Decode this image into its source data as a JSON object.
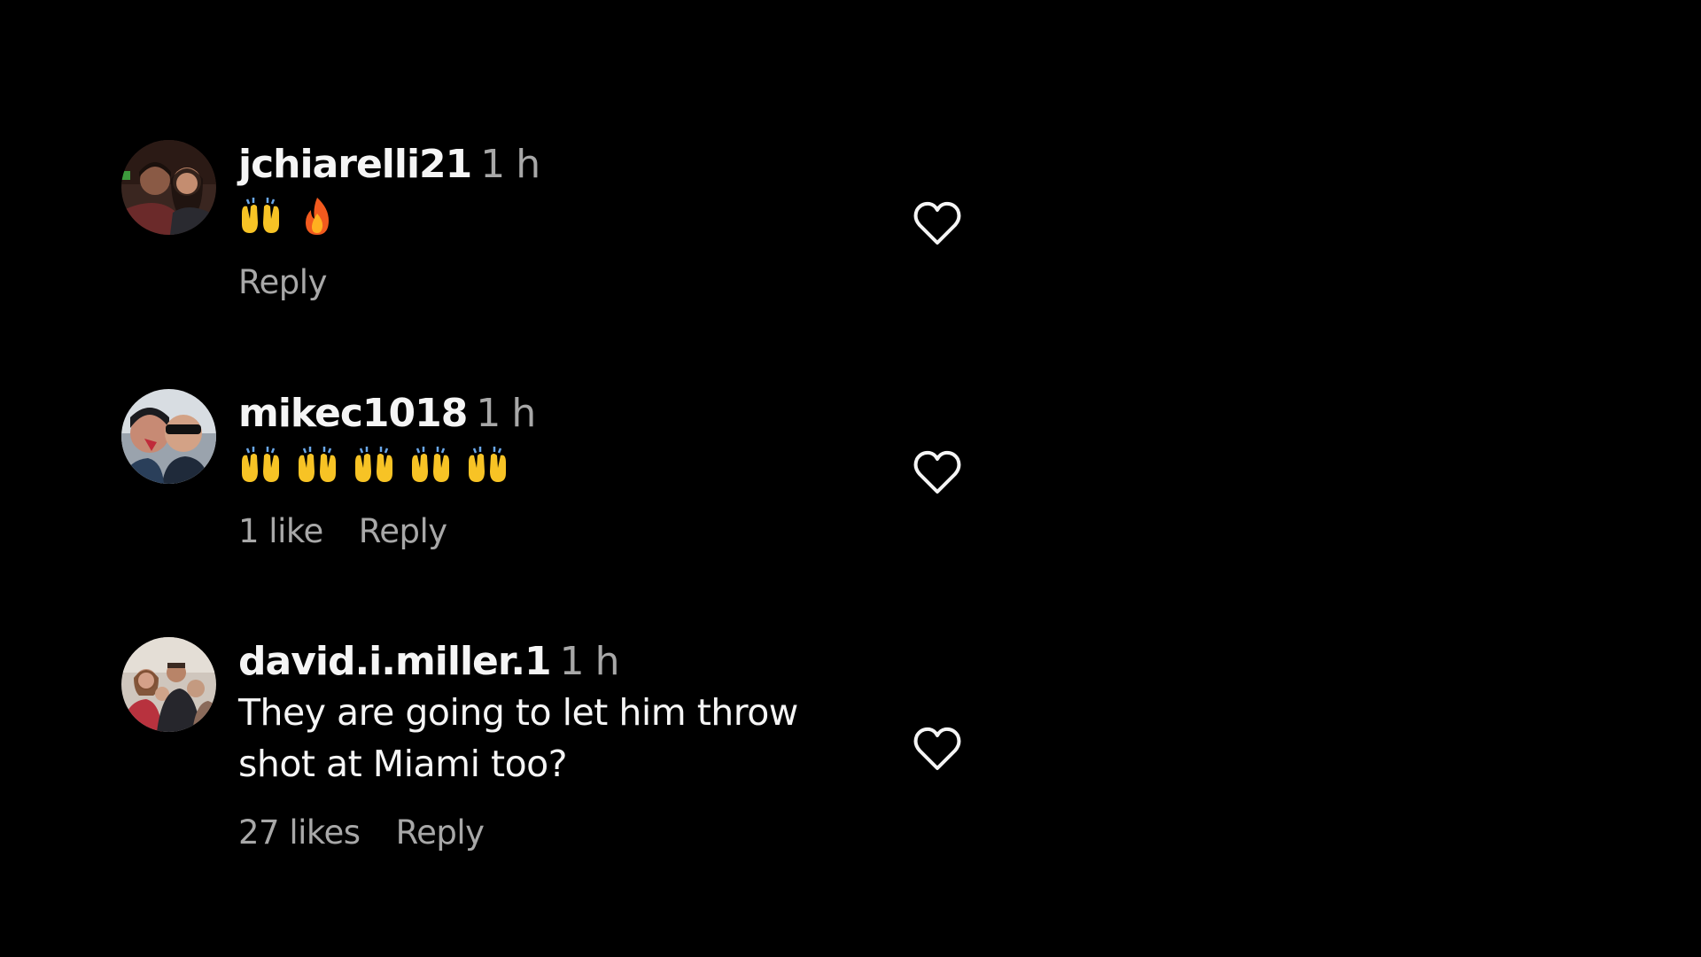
{
  "comments": [
    {
      "username": "jchiarelli21",
      "time": "1 h",
      "emojis": [
        "raising-hands",
        "fire"
      ],
      "text": "",
      "likes": "",
      "reply": "Reply",
      "avatar": "couple-avatar"
    },
    {
      "username": "mikec1018",
      "time": "1 h",
      "emojis": [
        "raising-hands",
        "raising-hands",
        "raising-hands",
        "raising-hands",
        "raising-hands"
      ],
      "text": "",
      "likes": "1 like",
      "reply": "Reply",
      "avatar": "selfie-avatar"
    },
    {
      "username": "david.i.miller.1",
      "time": "1 h",
      "emojis": [],
      "text": "They are going to let him throw shot at Miami too?",
      "likes": "27 likes",
      "reply": "Reply",
      "avatar": "family-avatar"
    }
  ],
  "icons": {
    "heart": "heart-outline-icon",
    "raising_hands": "raising-hands-emoji",
    "fire": "fire-emoji"
  },
  "colors": {
    "background": "#000000",
    "primary_text": "#f5f5f5",
    "secondary_text": "#a8a8a8"
  }
}
